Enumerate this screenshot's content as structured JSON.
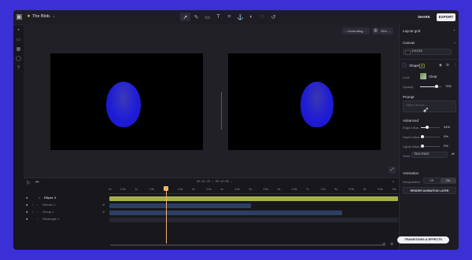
{
  "header": {
    "project_name": "The Blob.",
    "share_label": "SHARE",
    "export_label": "EXPORT",
    "tools": [
      "select",
      "pen",
      "rect",
      "text",
      "frame",
      "anchor",
      "blend",
      "lasso",
      "undo"
    ]
  },
  "canvas": {
    "status_label": "Generating...",
    "zoom_value": "35%"
  },
  "right_panel": {
    "layout_grid_label": "Layout grid",
    "canvas_label": "Canvas",
    "canvas_color": "1f1f23",
    "shape_name": "Shape",
    "shape_tag": "AI",
    "look_label": "Look",
    "look_value": "Clear",
    "opacity_label": "Opacity",
    "opacity_value": "75%",
    "prompt_label": "Prompt",
    "prompt_placeholder": "Object Kinsei...",
    "advanced_label": "Advanced",
    "edge_label": "Edge influe...",
    "edge_value": "34%",
    "depth_label": "Depth influe...",
    "depth_value": "0%",
    "lights_label": "Lights influe...",
    "lights_value": "0%",
    "seed_label": "Seed",
    "seed_value": "78217562X",
    "animation_label": "Animation",
    "interpolation_label": "Interpolation",
    "off_label": "Off",
    "on_label": "On",
    "render_label": "RENDER ANIMATION LAYER",
    "transitions_label": "TRANSITIONS & EFFECTS"
  },
  "timeline": {
    "timecode": "00:01:20 / 00:10:00",
    "ticks": [
      "0s",
      "0.5s",
      "1s",
      "1.5s",
      "2s",
      "2.5s",
      "3s",
      "3.5s",
      "4s",
      "4.5s",
      "5s",
      "5.5s",
      "6s",
      "6.5s",
      "7s",
      "7.5s",
      "8s",
      "8.5s",
      "9s",
      "9.5s",
      "10s"
    ],
    "layers": [
      {
        "name": "Ellipse 3"
      },
      {
        "name": "Render 1"
      },
      {
        "name": "Group 1"
      },
      {
        "name": "Rectangle 1"
      }
    ],
    "playhead_seconds": 2
  },
  "colors": {
    "accent": "#3b2fd6",
    "blob": "#1f1cd8",
    "track_green": "#a3b04a",
    "track_blue": "#2c3e63"
  }
}
